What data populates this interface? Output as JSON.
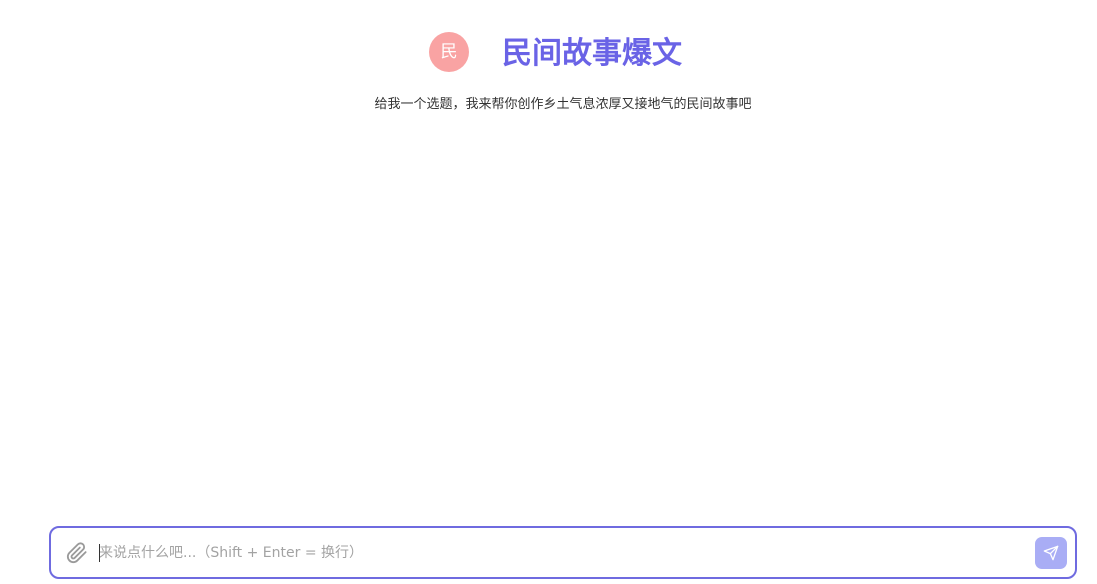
{
  "header": {
    "avatar_text": "民",
    "title": "民间故事爆文",
    "subtitle": "给我一个选题，我来帮你创作乡土气息浓厚又接地气的民间故事吧"
  },
  "composer": {
    "placeholder": "来说点什么吧...（Shift + Enter = 换行）",
    "value": ""
  },
  "colors": {
    "accent": "#6a63e6",
    "avatar_bg": "#f9a3a3",
    "send_button_bg": "#a9adf5",
    "composer_border": "#6f6be0"
  },
  "icons": {
    "attach": "paperclip-icon",
    "send": "send-icon"
  }
}
